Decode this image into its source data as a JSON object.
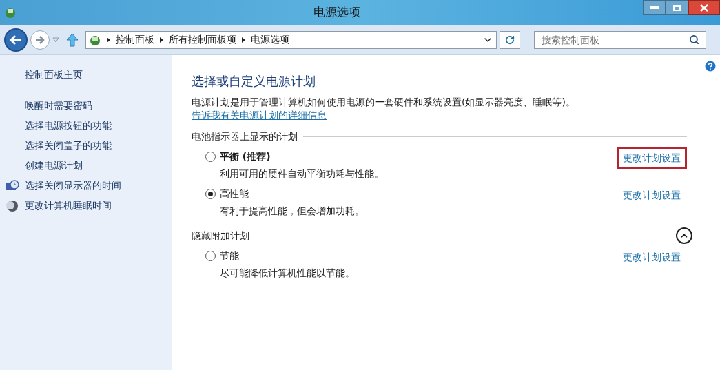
{
  "window": {
    "title": "电源选项"
  },
  "address_bar": {
    "breadcrumbs": [
      "控制面板",
      "所有控制面板项",
      "电源选项"
    ]
  },
  "search": {
    "placeholder": "搜索控制面板"
  },
  "sidebar": {
    "items": [
      {
        "label": "控制面板主页",
        "kind": "plain"
      },
      {
        "label": "唤醒时需要密码",
        "kind": "plain"
      },
      {
        "label": "选择电源按钮的功能",
        "kind": "plain"
      },
      {
        "label": "选择关闭盖子的功能",
        "kind": "plain"
      },
      {
        "label": "创建电源计划",
        "kind": "plain"
      },
      {
        "label": "选择关闭显示器的时间",
        "kind": "display"
      },
      {
        "label": "更改计算机睡眠时间",
        "kind": "sleep"
      }
    ]
  },
  "content": {
    "heading": "选择或自定义电源计划",
    "description": "电源计划是用于管理计算机如何使用电源的一套硬件和系统设置(如显示器亮度、睡眠等)。",
    "help_link": "告诉我有关电源计划的详细信息",
    "sections": [
      {
        "title": "电池指示器上显示的计划",
        "plans": [
          {
            "name": "平衡 (推荐)",
            "recommended": true,
            "selected": false,
            "description": "利用可用的硬件自动平衡功耗与性能。",
            "link": "更改计划设置",
            "highlighted": true
          },
          {
            "name": "高性能",
            "recommended": false,
            "selected": true,
            "description": "有利于提高性能，但会增加功耗。",
            "link": "更改计划设置",
            "highlighted": false
          }
        ]
      },
      {
        "title": "隐藏附加计划",
        "expanded": true,
        "plans": [
          {
            "name": "节能",
            "recommended": false,
            "selected": false,
            "description": "尽可能降低计算机性能以节能。",
            "link": "更改计划设置",
            "highlighted": false
          }
        ]
      }
    ]
  }
}
